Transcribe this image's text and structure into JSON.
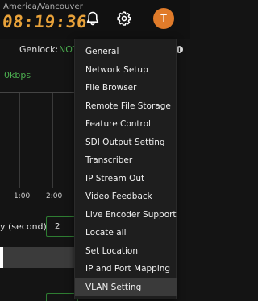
{
  "header": {
    "timezone": "America/Vancouver",
    "clock": "08:19:36",
    "avatar_initial": "T"
  },
  "status": {
    "genlock_label": "Genlock:",
    "genlock_value": "NOT",
    "bitrate": "0kbps"
  },
  "chart": {
    "ticks": [
      "1:00",
      "2:00"
    ]
  },
  "settings": {
    "delay_label": "y (second)",
    "delay_value": "2"
  },
  "menu": {
    "items": [
      {
        "label": "General"
      },
      {
        "label": "Network Setup"
      },
      {
        "label": "File Browser"
      },
      {
        "label": "Remote File Storage"
      },
      {
        "label": "Feature Control"
      },
      {
        "label": "SDI Output Setting"
      },
      {
        "label": "Transcriber"
      },
      {
        "label": "IP Stream Out"
      },
      {
        "label": "Video Feedback"
      },
      {
        "label": "Live Encoder Support"
      },
      {
        "label": "Locate all"
      },
      {
        "label": "Set Location"
      },
      {
        "label": "IP and Port Mapping"
      },
      {
        "label": "VLAN Setting"
      }
    ],
    "active_item": "VLAN Setting"
  },
  "colors": {
    "clock": "#e8a23a",
    "status_ok": "#4caf50",
    "avatar_bg": "#e07b2a",
    "menu_bg": "#1e1e1e",
    "menu_active_bg": "#3a3a3a"
  },
  "icons": {
    "bell": "bell-icon",
    "gear": "gear-icon",
    "info": "info-icon"
  }
}
